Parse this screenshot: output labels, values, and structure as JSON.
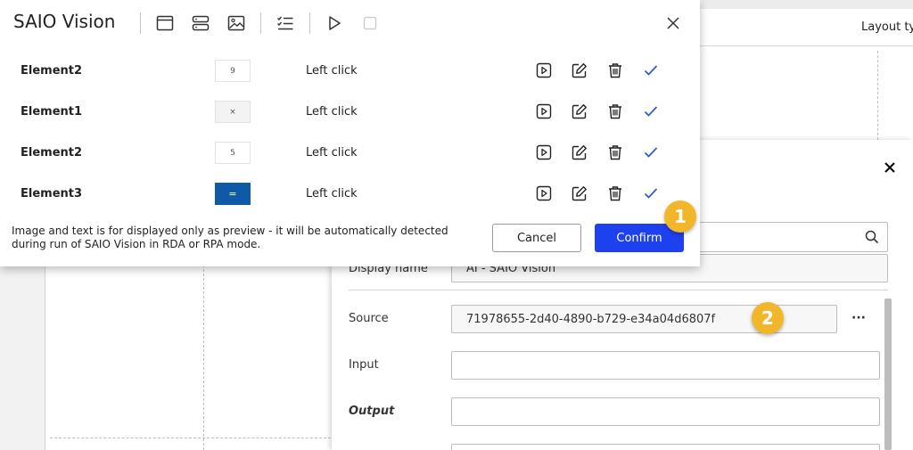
{
  "background": {
    "layout_type_label": "Layout ty"
  },
  "properties_panel": {
    "display_name_label": "Display name",
    "display_name_value": "AI - SAIO Vision",
    "source_label": "Source",
    "source_value": "71978655-2d40-4890-b729-e34a04d6807f",
    "more_label": "···",
    "input_label": "Input",
    "output_label": "Output"
  },
  "dialog": {
    "title": "SAIO Vision",
    "toolbar_icons": [
      "window-icon",
      "layout-rows-icon",
      "image-icon",
      "checklist-icon",
      "play-icon",
      "stop-icon"
    ],
    "rows": [
      {
        "element": "Element2",
        "preview": "9",
        "preview_style": "white",
        "action": "Left click"
      },
      {
        "element": "Element1",
        "preview": "×",
        "preview_style": "grey",
        "action": "Left click"
      },
      {
        "element": "Element2",
        "preview": "5",
        "preview_style": "white",
        "action": "Left click"
      },
      {
        "element": "Element3",
        "preview": "=",
        "preview_style": "blue",
        "action": "Left click"
      }
    ],
    "note_line1": "Image and text is for displayed only as preview - it will be automatically detected",
    "note_line2": "during run of SAIO Vision in RDA or RPA mode.",
    "cancel_label": "Cancel",
    "confirm_label": "Confirm"
  },
  "badges": [
    "1",
    "2"
  ],
  "colors": {
    "confirm_blue": "#1e41f0",
    "check_blue": "#2f56d6",
    "badge_yellow": "#f2b62b",
    "preview_blue": "#0f5aa6"
  }
}
